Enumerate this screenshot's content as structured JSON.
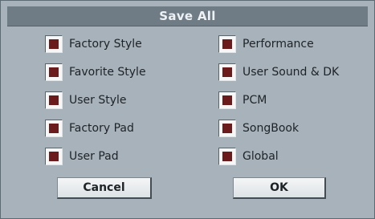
{
  "dialog": {
    "title": "Save All",
    "left_column": [
      {
        "label": "Factory Style",
        "checked": true
      },
      {
        "label": "Favorite Style",
        "checked": true
      },
      {
        "label": "User Style",
        "checked": true
      },
      {
        "label": "Factory Pad",
        "checked": true
      },
      {
        "label": "User Pad",
        "checked": true
      }
    ],
    "right_column": [
      {
        "label": "Performance",
        "checked": true
      },
      {
        "label": "User Sound & DK",
        "checked": true
      },
      {
        "label": "PCM",
        "checked": true
      },
      {
        "label": "SongBook",
        "checked": true
      },
      {
        "label": "Global",
        "checked": true
      }
    ],
    "cancel_label": "Cancel",
    "ok_label": "OK"
  },
  "colors": {
    "panel": "#a7b2ba",
    "titlebar": "#6f7c86",
    "check_mark": "#6b1b1b"
  }
}
